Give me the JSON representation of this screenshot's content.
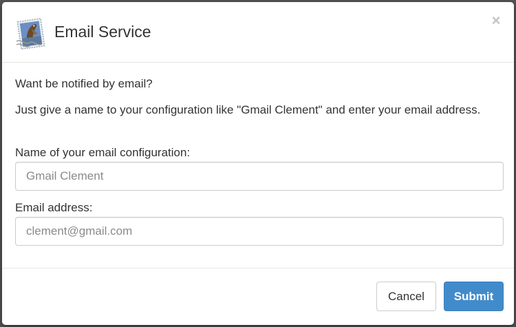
{
  "dialog": {
    "title": "Email Service",
    "icon": "mail-stamp-icon",
    "close_label": "×"
  },
  "body": {
    "question": "Want be notified by email?",
    "instructions": "Just give a name to your configuration like \"Gmail Clement\" and enter your email address.",
    "name_field": {
      "label": "Name of your email configuration:",
      "value": "",
      "placeholder": "Gmail Clement"
    },
    "email_field": {
      "label": "Email address:",
      "value": "",
      "placeholder": "clement@gmail.com"
    }
  },
  "footer": {
    "cancel_label": "Cancel",
    "submit_label": "Submit"
  },
  "colors": {
    "primary": "#428bca",
    "text": "#333333",
    "border": "#cccccc"
  }
}
